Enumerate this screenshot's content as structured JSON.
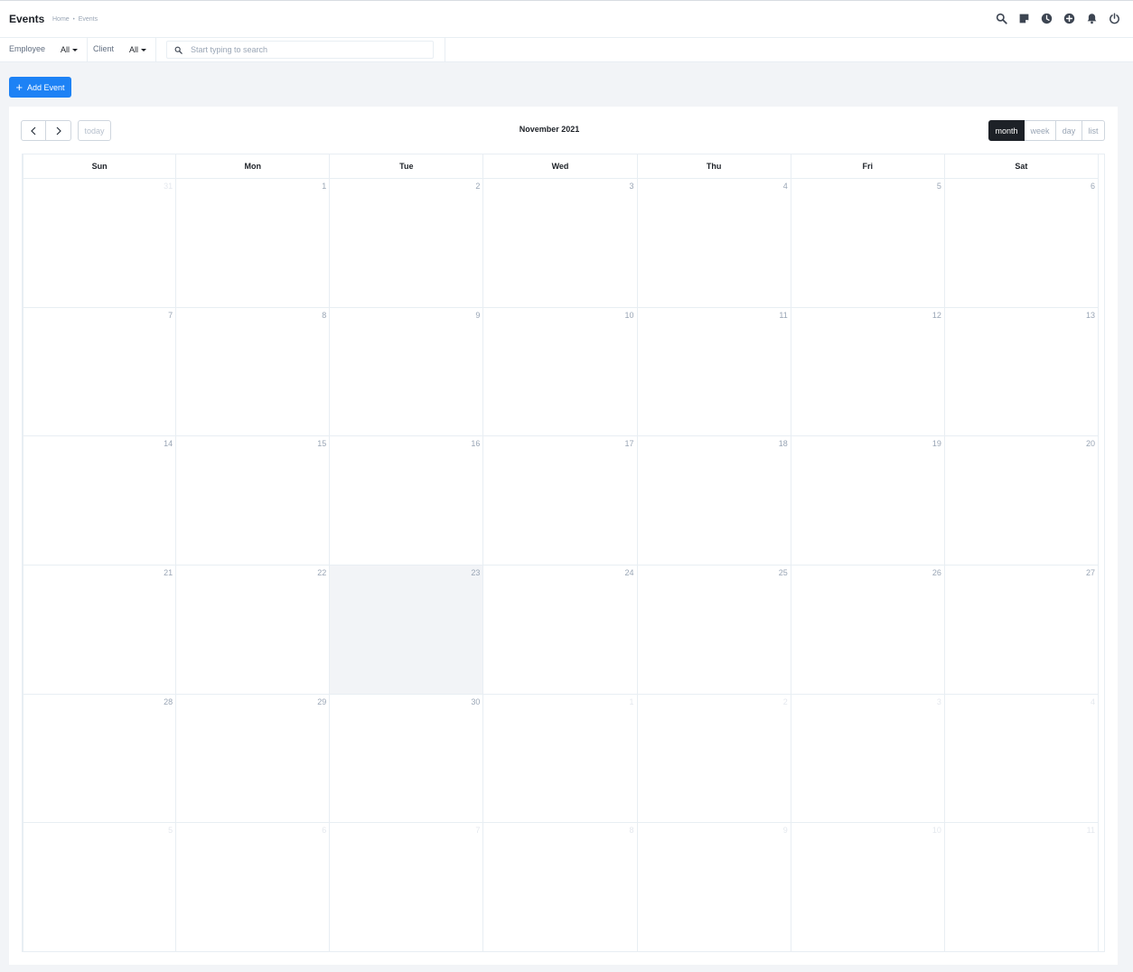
{
  "header": {
    "title": "Events",
    "breadcrumb": [
      "Home",
      "Events"
    ],
    "breadcrumb_separator": "•",
    "icons": [
      "search-icon",
      "sticky-note-icon",
      "clock-icon",
      "plus-circle-icon",
      "bell-icon",
      "power-icon"
    ]
  },
  "filters": {
    "employee_label": "Employee",
    "employee_value": "All",
    "client_label": "Client",
    "client_value": "All",
    "search_placeholder": "Start typing to search"
  },
  "actions": {
    "add_event_label": "Add Event"
  },
  "calendar": {
    "title": "November 2021",
    "today_label": "today",
    "views": [
      {
        "label": "month",
        "active": true
      },
      {
        "label": "week",
        "active": false
      },
      {
        "label": "day",
        "active": false
      },
      {
        "label": "list",
        "active": false
      }
    ],
    "weekdays": [
      "Sun",
      "Mon",
      "Tue",
      "Wed",
      "Thu",
      "Fri",
      "Sat"
    ],
    "weeks": [
      [
        {
          "d": "31",
          "other": true
        },
        {
          "d": "1"
        },
        {
          "d": "2"
        },
        {
          "d": "3"
        },
        {
          "d": "4"
        },
        {
          "d": "5"
        },
        {
          "d": "6"
        }
      ],
      [
        {
          "d": "7"
        },
        {
          "d": "8"
        },
        {
          "d": "9"
        },
        {
          "d": "10"
        },
        {
          "d": "11"
        },
        {
          "d": "12"
        },
        {
          "d": "13"
        }
      ],
      [
        {
          "d": "14"
        },
        {
          "d": "15"
        },
        {
          "d": "16"
        },
        {
          "d": "17"
        },
        {
          "d": "18"
        },
        {
          "d": "19"
        },
        {
          "d": "20"
        }
      ],
      [
        {
          "d": "21"
        },
        {
          "d": "22"
        },
        {
          "d": "23",
          "today": true
        },
        {
          "d": "24"
        },
        {
          "d": "25"
        },
        {
          "d": "26"
        },
        {
          "d": "27"
        }
      ],
      [
        {
          "d": "28"
        },
        {
          "d": "29"
        },
        {
          "d": "30"
        },
        {
          "d": "1",
          "other": true
        },
        {
          "d": "2",
          "other": true
        },
        {
          "d": "3",
          "other": true
        },
        {
          "d": "4",
          "other": true
        }
      ],
      [
        {
          "d": "5",
          "other": true
        },
        {
          "d": "6",
          "other": true
        },
        {
          "d": "7",
          "other": true
        },
        {
          "d": "8",
          "other": true
        },
        {
          "d": "9",
          "other": true
        },
        {
          "d": "10",
          "other": true
        },
        {
          "d": "11",
          "other": true
        }
      ]
    ]
  },
  "colors": {
    "accent": "#1d82f5",
    "dark": "#1d2127",
    "muted": "#99a5b5",
    "today_bg": "#f2f4f7"
  }
}
